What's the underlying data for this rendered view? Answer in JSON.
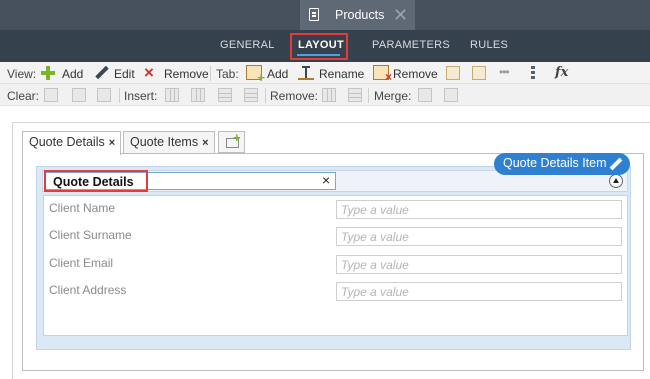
{
  "titlebar": {
    "title": "Products",
    "close_glyph": "✕"
  },
  "nav": {
    "tabs": [
      {
        "label": "GENERAL"
      },
      {
        "label": "LAYOUT"
      },
      {
        "label": "PARAMETERS"
      },
      {
        "label": "RULES"
      }
    ],
    "active_tab": "LAYOUT"
  },
  "toolbar1": {
    "view_label": "View:",
    "add_label": "Add",
    "edit_label": "Edit",
    "remove_label": "Remove",
    "tab_label": "Tab:",
    "tab_add_label": "Add",
    "tab_rename_label": "Rename",
    "tab_remove_label": "Remove",
    "dots_glyph": "•••",
    "fx_label": "fx"
  },
  "toolbar2": {
    "clear_label": "Clear:",
    "insert_label": "Insert:",
    "remove_label": "Remove:",
    "merge_label": "Merge:"
  },
  "tabs": [
    {
      "label": "Quote Details",
      "close": "×"
    },
    {
      "label": "Quote Items",
      "close": "×"
    }
  ],
  "badge": {
    "label": "Quote Details Item"
  },
  "section": {
    "name_value": "Quote Details",
    "clear_glyph": "×"
  },
  "fields": [
    {
      "label": "Client Name",
      "placeholder": "Type a value"
    },
    {
      "label": "Client Surname",
      "placeholder": "Type a value"
    },
    {
      "label": "Client Email",
      "placeholder": "Type a value"
    },
    {
      "label": "Client Address",
      "placeholder": "Type a value"
    }
  ],
  "colors": {
    "titlebar": "#46505c",
    "navbar": "#35414c",
    "accent": "#2f80d1",
    "highlight": "#e53b3b"
  }
}
